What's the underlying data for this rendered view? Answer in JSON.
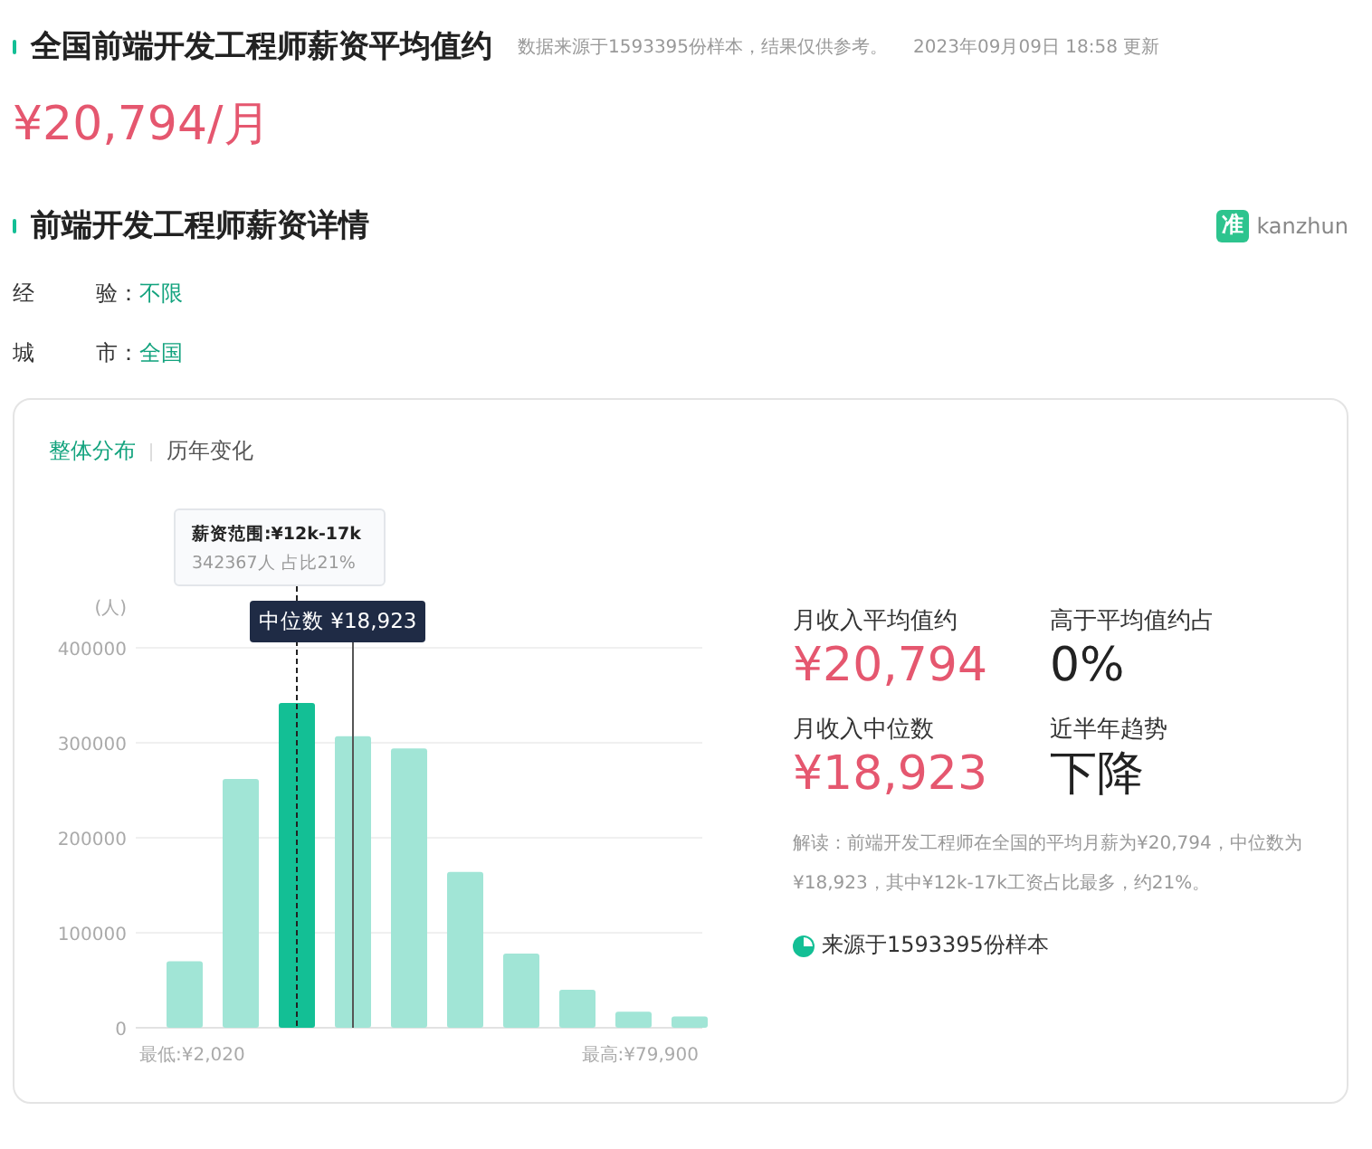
{
  "header": {
    "title": "全国前端开发工程师薪资平均值约",
    "source_note": "数据来源于1593395份样本，结果仅供参考。",
    "updated": "2023年09月09日 18:58 更新",
    "average": "¥20,794/月"
  },
  "details": {
    "title": "前端开发工程师薪资详情",
    "logo_text": "kanzhun",
    "logo_mark": "准",
    "filters": [
      {
        "label_first": "经",
        "label_last": "验：",
        "value": "不限"
      },
      {
        "label_first": "城",
        "label_last": "市：",
        "value": "全国"
      }
    ]
  },
  "tabs": [
    {
      "label": "整体分布",
      "selected": true
    },
    {
      "label": "历年变化",
      "selected": false
    }
  ],
  "chart_data": {
    "type": "bar",
    "ylabel": "(人)",
    "yticks": [
      0,
      100000,
      200000,
      300000,
      400000
    ],
    "ylim": [
      0,
      400000
    ],
    "grid": true,
    "series": [
      {
        "color": "#a1e5d6",
        "values": [
          70000,
          262000,
          null,
          307000,
          294000,
          164000,
          78000,
          40000,
          17000,
          12000
        ]
      },
      {
        "color": "#13bf95",
        "values": [
          null,
          null,
          342000,
          null,
          null,
          null,
          null,
          null,
          null,
          null
        ]
      }
    ],
    "annotations": [
      "薪资范围:¥12k-17k",
      "342367人  占比21%",
      "中位数 ¥18,923"
    ]
  },
  "chart_axis_labels": {
    "min": "最低:¥2,020",
    "max": "最高:¥79,900"
  },
  "stats": [
    {
      "label": "月收入平均值约",
      "value": "¥20,794",
      "kind": "money"
    },
    {
      "label": "高于平均值约占",
      "value": "0%",
      "kind": "plain"
    },
    {
      "label": "月收入中位数",
      "value": "¥18,923",
      "kind": "money"
    },
    {
      "label": "近半年趋势",
      "value": "下降",
      "kind": "plain"
    }
  ],
  "interpretation": "解读：前端开发工程师在全国的平均月薪为¥20,794，中位数为¥18,923，其中¥12k-17k工资占比最多，约21%。",
  "sample_source": "来源于1593395份样本"
}
